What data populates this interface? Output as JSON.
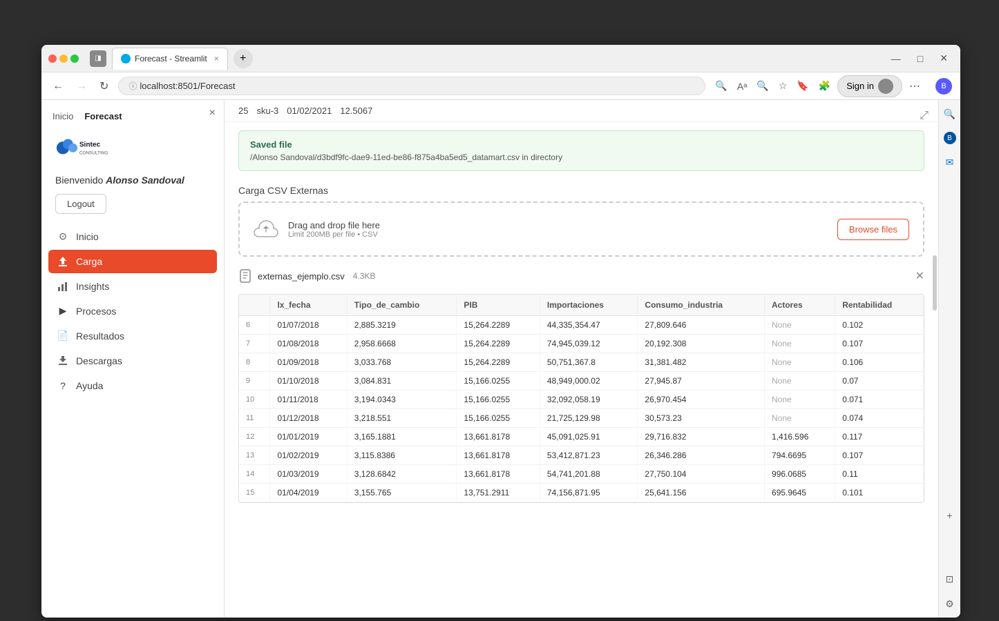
{
  "browser": {
    "tab_title": "Forecast - Streamlit",
    "url": "localhost:8501/Forecast",
    "close_label": "×",
    "new_tab_label": "+",
    "sign_in_label": "Sign in"
  },
  "sidebar": {
    "close_icon": "×",
    "nav_inicio": "Inicio",
    "nav_forecast": "Forecast",
    "welcome_prefix": "Bienvenido ",
    "welcome_name": "Alonso Sandoval",
    "logout_label": "Logout",
    "items": [
      {
        "id": "inicio",
        "label": "Inicio",
        "icon": "⊙"
      },
      {
        "id": "carga",
        "label": "Carga",
        "icon": "⬆",
        "active": true
      },
      {
        "id": "insights",
        "label": "Insights",
        "icon": "📊"
      },
      {
        "id": "procesos",
        "label": "Procesos",
        "icon": "▶"
      },
      {
        "id": "resultados",
        "label": "Resultados",
        "icon": "📄"
      },
      {
        "id": "descargas",
        "label": "Descargas",
        "icon": "⬇"
      },
      {
        "id": "ayuda",
        "label": "Ayuda",
        "icon": "?"
      }
    ]
  },
  "row25": {
    "number": "25",
    "sku": "sku-3",
    "date": "01/02/2021",
    "value": "12.5067"
  },
  "saved_file": {
    "title": "Saved file",
    "path": "/Alonso Sandoval/d3bdf9fc-dae9-11ed-be86-f875a4ba5ed5_datamart.csv in directory"
  },
  "upload_section": {
    "label": "Carga CSV Externas",
    "drag_text": "Drag and drop file here",
    "limit_text": "Limit 200MB per file • CSV",
    "browse_label": "Browse files",
    "file_name": "externas_ejemplo.csv",
    "file_size": "4.3KB"
  },
  "table": {
    "columns": [
      "",
      "lx_fecha",
      "Tipo_de_cambio",
      "PIB",
      "Importaciones",
      "Consumo_industria",
      "Actores",
      "Rentabilidad"
    ],
    "rows": [
      [
        "6",
        "01/07/2018",
        "2,885.3219",
        "15,264.2289",
        "44,335,354.47",
        "27,809.646",
        "None",
        "0.102"
      ],
      [
        "7",
        "01/08/2018",
        "2,958.6668",
        "15,264.2289",
        "74,945,039.12",
        "20,192.308",
        "None",
        "0.107"
      ],
      [
        "8",
        "01/09/2018",
        "3,033.768",
        "15,264.2289",
        "50,751,367.8",
        "31,381.482",
        "None",
        "0.106"
      ],
      [
        "9",
        "01/10/2018",
        "3,084.831",
        "15,166.0255",
        "48,949,000.02",
        "27,945.87",
        "None",
        "0.07"
      ],
      [
        "10",
        "01/11/2018",
        "3,194.0343",
        "15,166.0255",
        "32,092,058.19",
        "26,970.454",
        "None",
        "0.071"
      ],
      [
        "11",
        "01/12/2018",
        "3,218.551",
        "15,166.0255",
        "21,725,129.98",
        "30,573.23",
        "None",
        "0.074"
      ],
      [
        "12",
        "01/01/2019",
        "3,165.1881",
        "13,661.8178",
        "45,091,025.91",
        "29,716.832",
        "1,416.596",
        "0.117"
      ],
      [
        "13",
        "01/02/2019",
        "3,115.8386",
        "13,661.8178",
        "53,412,871.23",
        "26,346.286",
        "794.6695",
        "0.107"
      ],
      [
        "14",
        "01/03/2019",
        "3,128.6842",
        "13,661.8178",
        "54,741,201.88",
        "27,750.104",
        "996.0685",
        "0.11"
      ],
      [
        "15",
        "01/04/2019",
        "3,155.765",
        "13,751.2911",
        "74,156,871.95",
        "25,641.156",
        "695.9645",
        "0.101"
      ]
    ]
  }
}
